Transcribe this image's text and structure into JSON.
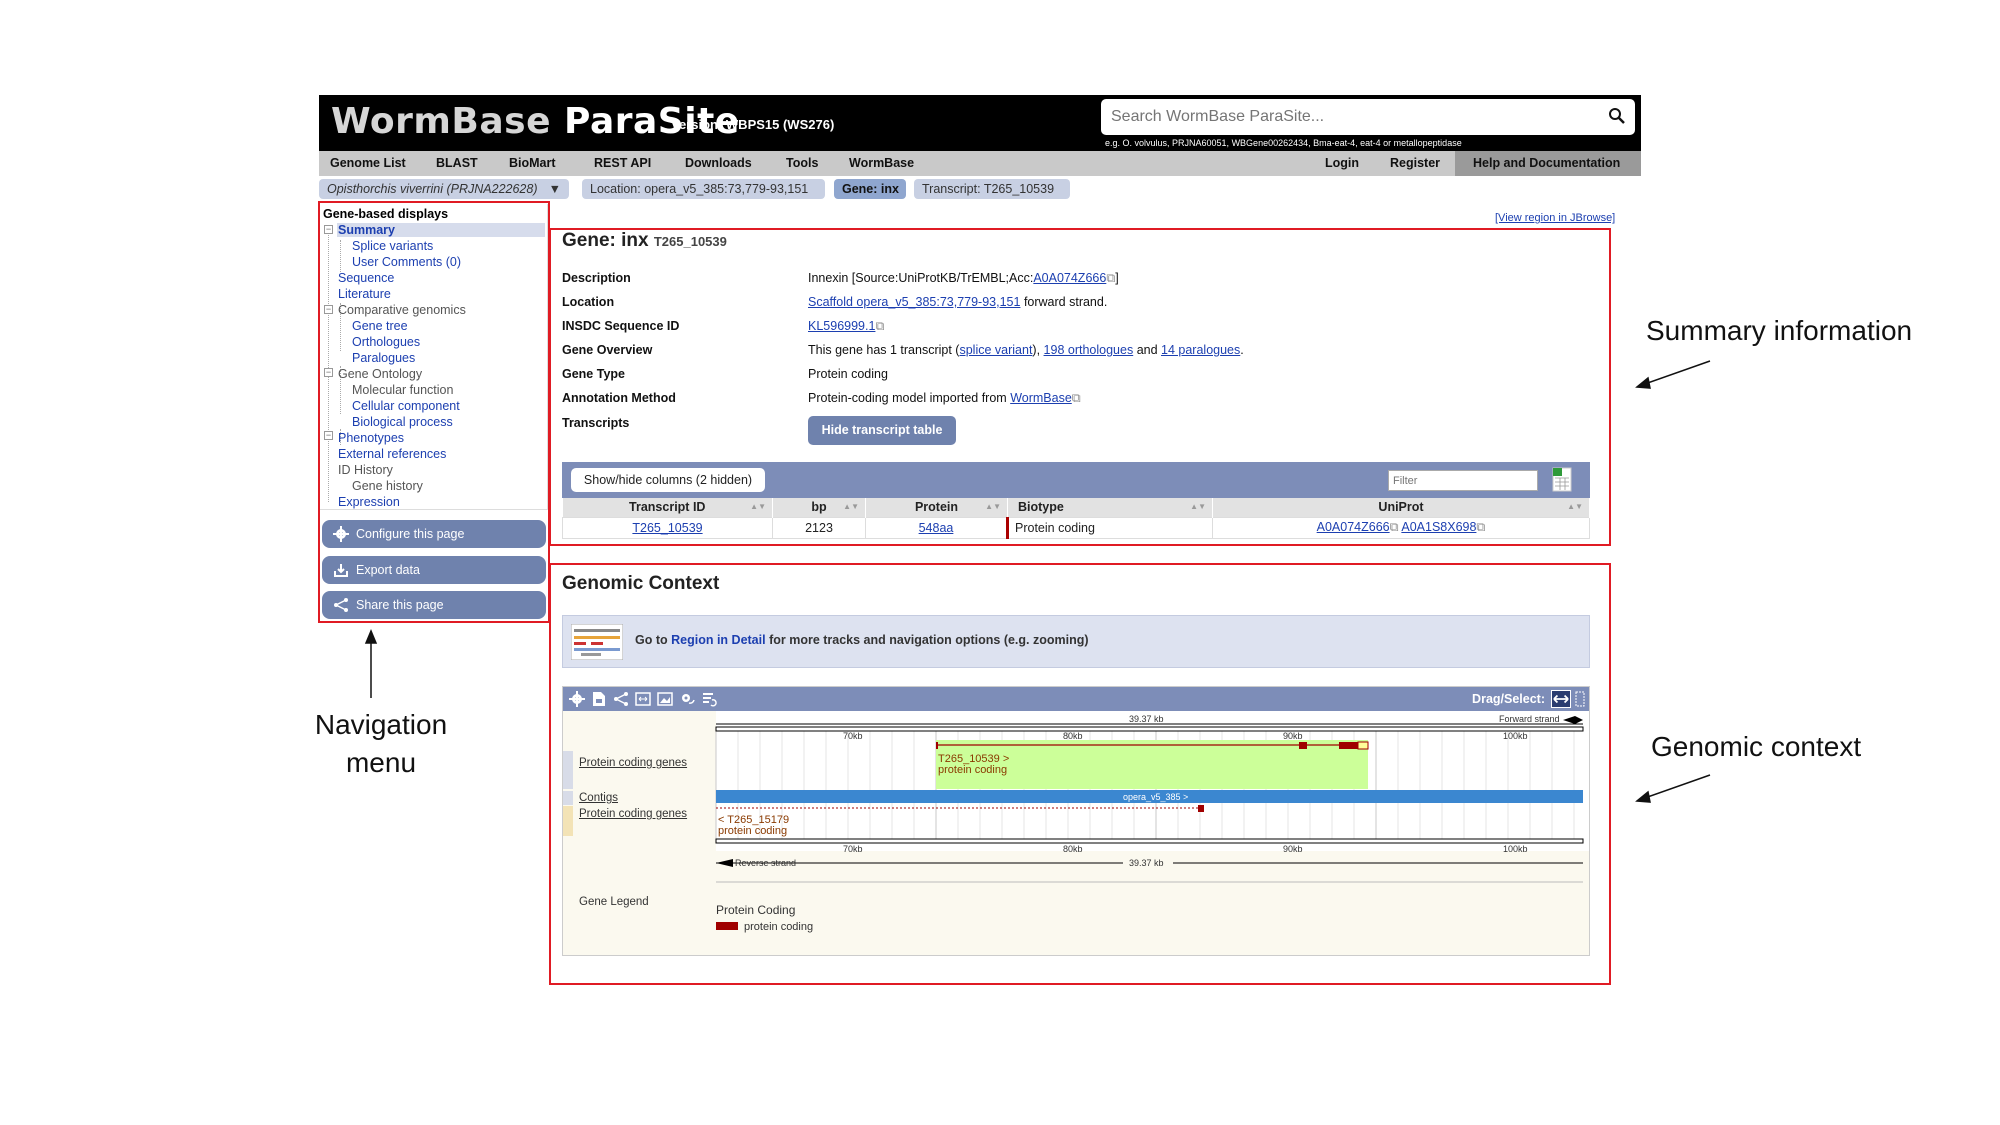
{
  "header": {
    "logo_word1": "WormBase",
    "logo_word2": "ParaSite",
    "version": "Version: WBPS15 (WS276)",
    "search_placeholder": "Search WormBase ParaSite...",
    "search_example": "e.g. O. volvulus, PRJNA60051, WBGene00262434, Bma-eat-4, eat-4 or metallopeptidase"
  },
  "nav": {
    "left": [
      "Genome List",
      "BLAST",
      "BioMart",
      "REST API",
      "Downloads",
      "Tools",
      "WormBase"
    ],
    "right": [
      "Login",
      "Register",
      "Help and Documentation"
    ]
  },
  "breadcrumbs": {
    "species": "Opisthorchis viverrini (PRJNA222628)",
    "species_dropdown": "▼",
    "location": "Location: opera_v5_385:73,779-93,151",
    "gene": "Gene: inx",
    "transcript": "Transcript: T265_10539"
  },
  "leftnav": {
    "title": "Gene-based displays",
    "items": [
      "Summary",
      "Splice variants",
      "User Comments (0)",
      "Sequence",
      "Literature",
      "Comparative genomics",
      "Gene tree",
      "Orthologues",
      "Paralogues",
      "Gene Ontology",
      "Molecular function",
      "Cellular component",
      "Biological process",
      "Phenotypes",
      "External references",
      "ID History",
      "Gene history",
      "Expression"
    ],
    "buttons": [
      "Configure this page",
      "Export data",
      "Share this page"
    ]
  },
  "summary": {
    "jbrowse_link": "[View region in JBrowse]",
    "title": "Gene: inx",
    "title_id": "T265_10539",
    "rows": {
      "description_label": "Description",
      "description_pre": "Innexin [Source:UniProtKB/TrEMBL;Acc:",
      "description_link": "A0A074Z666",
      "description_post": "]",
      "location_label": "Location",
      "location_link": "Scaffold opera_v5_385:73,779-93,151",
      "location_post": "forward strand.",
      "insdc_label": "INSDC Sequence ID",
      "insdc_link": "KL596999.1",
      "overview_label": "Gene Overview",
      "overview_pre": "This gene has 1 transcript (",
      "overview_link1": "splice variant",
      "overview_mid1": "),",
      "overview_link2": "198 orthologues",
      "overview_mid2": "and",
      "overview_link3": "14 paralogues",
      "overview_post": ".",
      "type_label": "Gene Type",
      "type_value": "Protein coding",
      "annotation_label": "Annotation Method",
      "annotation_pre": "Protein-coding model imported from",
      "annotation_link": "WormBase",
      "transcripts_label": "Transcripts"
    },
    "hide_table_button": "Hide transcript table",
    "showhide_button": "Show/hide columns (2 hidden)",
    "filter_placeholder": "Filter",
    "table": {
      "headers": [
        "Transcript ID",
        "bp",
        "Protein",
        "Biotype",
        "UniProt"
      ],
      "row": {
        "transcript_id": "T265_10539",
        "bp": "2123",
        "protein": "548aa",
        "biotype": "Protein coding",
        "uniprot1": "A0A074Z666",
        "uniprot2": "A0A1S8X698"
      }
    }
  },
  "genomic_context": {
    "title": "Genomic Context",
    "hint_pre": "Go to",
    "hint_link": "Region in Detail",
    "hint_post": "for more tracks and navigation options (e.g. zooming)",
    "drag_select": "Drag/Select:",
    "scale_length": "39.37 kb",
    "forward_strand": "Forward strand",
    "reverse_strand": "Reverse strand",
    "ticks": [
      "70kb",
      "80kb",
      "90kb",
      "100kb"
    ],
    "tracks": {
      "protein_coding_top": "Protein coding genes",
      "contigs": "Contigs",
      "protein_coding_bottom": "Protein coding genes",
      "gene_legend": "Gene Legend"
    },
    "features": {
      "fwd_gene_id": "T265_10539 >",
      "fwd_gene_type": "protein coding",
      "contig_label": "opera_v5_385 >",
      "rev_gene_id": "< T265_15179",
      "rev_gene_type": "protein coding"
    },
    "legend": {
      "heading": "Protein Coding",
      "item": "protein coding",
      "color": "#a00000"
    }
  },
  "annotations": {
    "summary": "Summary information",
    "genomic": "Genomic context",
    "nav_line1": "Navigation",
    "nav_line2": "menu"
  },
  "colors": {
    "accent": "#6f82ad",
    "highlight_box": "#e01b24",
    "gene_box": "#ccff99",
    "contig": "#3b87d0"
  }
}
